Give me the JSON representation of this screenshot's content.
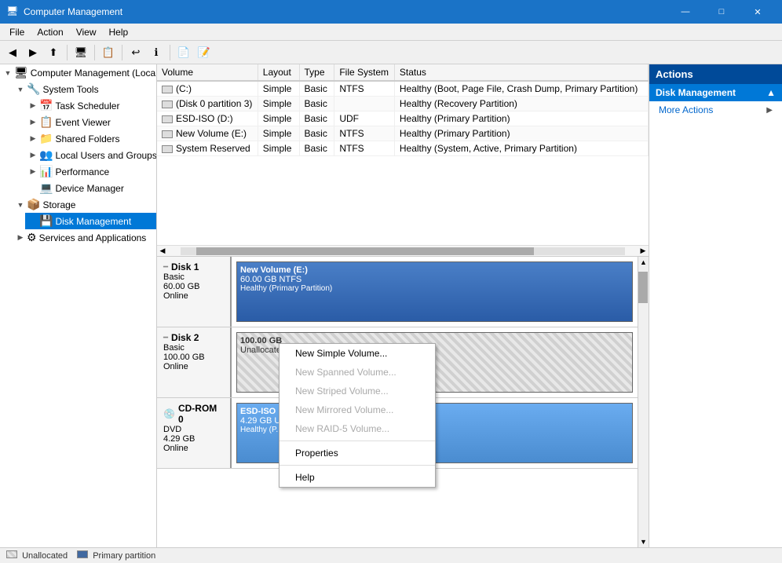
{
  "titleBar": {
    "title": "Computer Management",
    "iconText": "🖥",
    "minBtn": "—",
    "maxBtn": "□",
    "closeBtn": "✕"
  },
  "menuBar": {
    "items": [
      "File",
      "Action",
      "View",
      "Help"
    ]
  },
  "toolbar": {
    "buttons": [
      "◀",
      "▶",
      "⬆",
      "🖥",
      "📋",
      "📁",
      "↩",
      "ℹ",
      "📄",
      "📝"
    ]
  },
  "tree": {
    "items": [
      {
        "id": "root",
        "label": "Computer Management (Local",
        "indent": 0,
        "expand": "▼",
        "icon": "🖥"
      },
      {
        "id": "system-tools",
        "label": "System Tools",
        "indent": 1,
        "expand": "▼",
        "icon": "🔧"
      },
      {
        "id": "task-scheduler",
        "label": "Task Scheduler",
        "indent": 2,
        "expand": "▶",
        "icon": "📅"
      },
      {
        "id": "event-viewer",
        "label": "Event Viewer",
        "indent": 2,
        "expand": "▶",
        "icon": "📋"
      },
      {
        "id": "shared-folders",
        "label": "Shared Folders",
        "indent": 2,
        "expand": "▶",
        "icon": "📁"
      },
      {
        "id": "local-users",
        "label": "Local Users and Groups",
        "indent": 2,
        "expand": "▶",
        "icon": "👥"
      },
      {
        "id": "performance",
        "label": "Performance",
        "indent": 2,
        "expand": "▶",
        "icon": "📊"
      },
      {
        "id": "device-manager",
        "label": "Device Manager",
        "indent": 2,
        "expand": "",
        "icon": "💻"
      },
      {
        "id": "storage",
        "label": "Storage",
        "indent": 1,
        "expand": "▼",
        "icon": "📦"
      },
      {
        "id": "disk-management",
        "label": "Disk Management",
        "indent": 2,
        "expand": "",
        "icon": "💾",
        "selected": true
      },
      {
        "id": "services-apps",
        "label": "Services and Applications",
        "indent": 1,
        "expand": "▶",
        "icon": "⚙"
      }
    ]
  },
  "table": {
    "columns": [
      "Volume",
      "Layout",
      "Type",
      "File System",
      "Status"
    ],
    "colWidths": [
      "110",
      "70",
      "55",
      "80",
      "300"
    ],
    "rows": [
      {
        "volume": "(C:)",
        "layout": "Simple",
        "type": "Basic",
        "fs": "NTFS",
        "status": "Healthy (Boot, Page File, Crash Dump, Primary Partition)"
      },
      {
        "volume": "(Disk 0 partition 3)",
        "layout": "Simple",
        "type": "Basic",
        "fs": "",
        "status": "Healthy (Recovery Partition)"
      },
      {
        "volume": "ESD-ISO (D:)",
        "layout": "Simple",
        "type": "Basic",
        "fs": "UDF",
        "status": "Healthy (Primary Partition)"
      },
      {
        "volume": "New Volume (E:)",
        "layout": "Simple",
        "type": "Basic",
        "fs": "NTFS",
        "status": "Healthy (Primary Partition)"
      },
      {
        "volume": "System Reserved",
        "layout": "Simple",
        "type": "Basic",
        "fs": "NTFS",
        "status": "Healthy (System, Active, Primary Partition)"
      }
    ]
  },
  "disks": [
    {
      "id": "disk1",
      "name": "Disk 1",
      "type": "Basic",
      "size": "60.00 GB",
      "status": "Online",
      "partitions": [
        {
          "name": "New Volume (E:)",
          "size": "60.00 GB NTFS",
          "status": "Healthy (Primary Partition)",
          "style": "ntfs-blue",
          "flex": 1
        }
      ]
    },
    {
      "id": "disk2",
      "name": "Disk 2",
      "type": "Basic",
      "size": "100.00 GB",
      "status": "Online",
      "partitions": [
        {
          "name": "100.00 GB",
          "size": "Unallocated",
          "style": "unallocated",
          "flex": 1
        }
      ]
    },
    {
      "id": "cdrom0",
      "name": "CD-ROM 0",
      "type": "DVD",
      "size": "4.29 GB",
      "status": "Online",
      "partitions": [
        {
          "name": "ESD-ISO",
          "size": "4.29 GB UDF",
          "status": "Healthy (P...",
          "style": "cdrom",
          "flex": 1
        }
      ]
    }
  ],
  "contextMenu": {
    "items": [
      {
        "label": "New Simple Volume...",
        "enabled": true
      },
      {
        "label": "New Spanned Volume...",
        "enabled": false
      },
      {
        "label": "New Striped Volume...",
        "enabled": false
      },
      {
        "label": "New Mirrored Volume...",
        "enabled": false
      },
      {
        "label": "New RAID-5 Volume...",
        "enabled": false
      },
      {
        "separator": true
      },
      {
        "label": "Properties",
        "enabled": true
      },
      {
        "separator": true
      },
      {
        "label": "Help",
        "enabled": true
      }
    ]
  },
  "actionsPanel": {
    "title": "Actions",
    "sections": [
      {
        "header": "Disk Management",
        "items": [
          {
            "label": "More Actions",
            "hasArrow": true
          }
        ]
      }
    ]
  },
  "statusBar": {
    "legends": [
      {
        "type": "unallocated",
        "label": "Unallocated"
      },
      {
        "type": "primary",
        "label": "Primary partition"
      }
    ]
  }
}
